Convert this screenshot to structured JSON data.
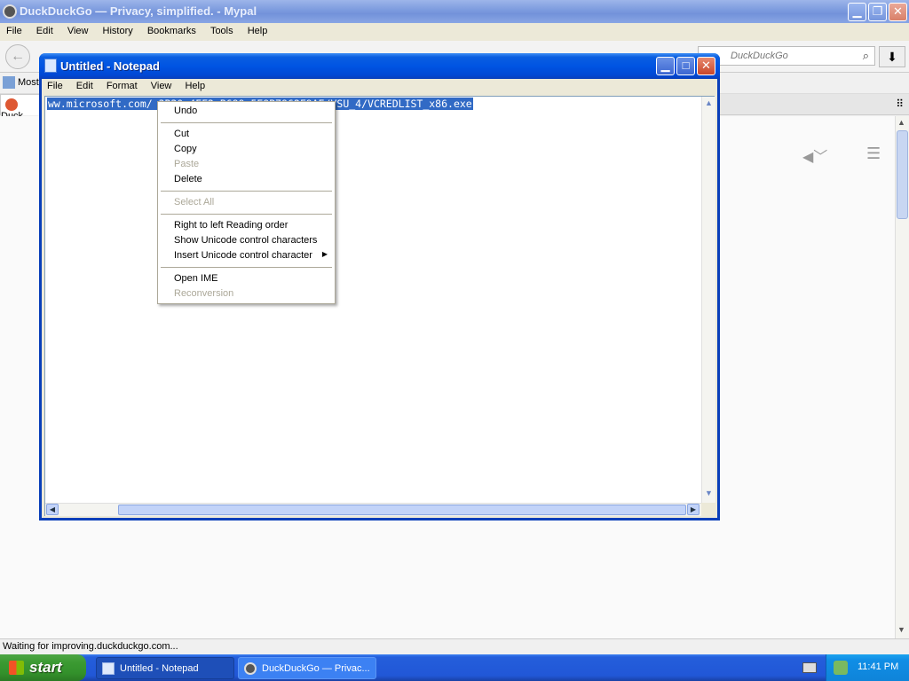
{
  "browser": {
    "title": "DuckDuckGo — Privacy, simplified. - Mypal",
    "menu": [
      "File",
      "Edit",
      "View",
      "History",
      "Bookmarks",
      "Tools",
      "Help"
    ],
    "search_placeholder": "DuckDuckGo",
    "bookmark_label": "Most",
    "tab_label": "Duck",
    "status": "Waiting for improving.duckduckgo.com..."
  },
  "notepad": {
    "title": "Untitled - Notepad",
    "menu": [
      "File",
      "Edit",
      "Format",
      "View",
      "Help"
    ],
    "selected_text": "ww.microsoft.com/                         3B20-4FF2-B699-5E9B7962F9AE/VSU_4/VCREDLIST_x86.exe"
  },
  "context_menu": {
    "items": [
      {
        "label": "Undo",
        "enabled": true
      },
      {
        "label": "Cut",
        "enabled": true
      },
      {
        "label": "Copy",
        "enabled": true
      },
      {
        "label": "Paste",
        "enabled": false
      },
      {
        "label": "Delete",
        "enabled": true
      },
      {
        "label": "Select All",
        "enabled": false
      },
      {
        "label": "Right to left Reading order",
        "enabled": true
      },
      {
        "label": "Show Unicode control characters",
        "enabled": true
      },
      {
        "label": "Insert Unicode control character",
        "enabled": true,
        "submenu": true
      },
      {
        "label": "Open IME",
        "enabled": true
      },
      {
        "label": "Reconversion",
        "enabled": false
      }
    ]
  },
  "taskbar": {
    "start_label": "start",
    "buttons": [
      {
        "label": "Untitled - Notepad",
        "active": true,
        "icon": "notepad-icon"
      },
      {
        "label": "DuckDuckGo — Privac...",
        "active": false,
        "icon": "mypal-icon"
      }
    ],
    "clock": "11:41 PM"
  },
  "icons": {
    "back": "←",
    "search": "⌕",
    "download": "⬇",
    "minimize": "▁",
    "maximize": "□",
    "restore": "❐",
    "close": "✕",
    "submenu_arrow": "▶",
    "menu": "☰",
    "megaphone": "📢"
  }
}
